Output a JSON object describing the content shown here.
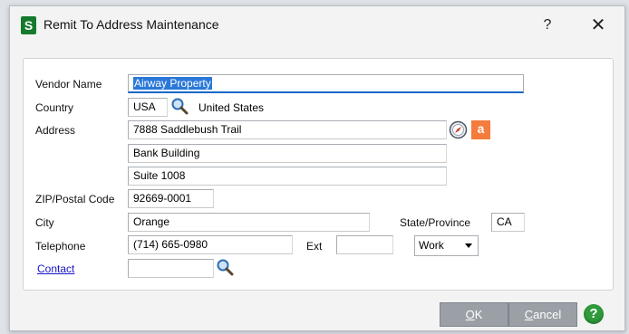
{
  "window": {
    "app_icon_letter": "S",
    "title": "Remit To Address Maintenance",
    "help_glyph": "?",
    "close_glyph": "✕"
  },
  "form": {
    "vendor_name_label": "Vendor Name",
    "vendor_name_value": "Airway Property",
    "country_label": "Country",
    "country_code": "USA",
    "country_name": "United States",
    "address_label": "Address",
    "address_line1": "7888 Saddlebush Trail",
    "address_line2": "Bank Building",
    "address_line3": "Suite 1008",
    "zip_label": "ZIP/Postal Code",
    "zip_value": "92669-0001",
    "city_label": "City",
    "city_value": "Orange",
    "state_label": "State/Province",
    "state_value": "CA",
    "telephone_label": "Telephone",
    "telephone_value": "(714) 665-0980",
    "ext_label": "Ext",
    "ext_value": "",
    "phone_type_value": "Work",
    "contact_label": "Contact",
    "contact_value": "",
    "amazon_glyph": "a"
  },
  "buttons": {
    "ok_accel": "O",
    "ok_rest": "K",
    "cancel_accel": "C",
    "cancel_rest": "ancel",
    "help_glyph": "?"
  },
  "colors": {
    "selection": "#2a78d7",
    "link": "#1515c9",
    "app_icon": "#157a2d",
    "help_button": "#2f9b3a",
    "amazon_button": "#f47c3c"
  }
}
